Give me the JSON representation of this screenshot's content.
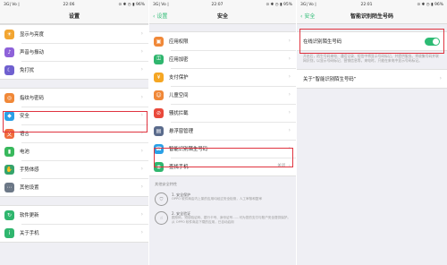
{
  "colors": {
    "accent": "#2dbb74",
    "highlight": "#e0333f"
  },
  "phone1": {
    "status": {
      "carrier": "3G| Vo |",
      "time": "22:06",
      "right": "⊙ ✱ ◷ ▮ 96%"
    },
    "title": "设置",
    "group1": [
      {
        "label": "显示与亮度",
        "icon": "sun-icon",
        "color": "#f2a531",
        "glyph": "☀"
      },
      {
        "label": "声音与振动",
        "icon": "speaker-icon",
        "color": "#8e62d9",
        "glyph": "♪"
      },
      {
        "label": "免打扰",
        "icon": "moon-icon",
        "color": "#6f60cf",
        "glyph": "☾"
      }
    ],
    "group2": [
      {
        "label": "指纹与密码",
        "icon": "fingerprint-icon",
        "color": "#f08838",
        "glyph": "◎"
      },
      {
        "label": "安全",
        "icon": "shield-icon",
        "color": "#2aa0e6",
        "glyph": "◆"
      },
      {
        "label": "语言",
        "icon": "language-icon",
        "color": "#f06b3c",
        "glyph": "文"
      },
      {
        "label": "电池",
        "icon": "battery-icon",
        "color": "#38b85c",
        "glyph": "▮"
      },
      {
        "label": "手势体感",
        "icon": "gesture-icon",
        "color": "#35a46c",
        "glyph": "✋"
      },
      {
        "label": "其他设置",
        "icon": "more-settings-icon",
        "color": "#6c7887",
        "glyph": "⋯"
      }
    ],
    "group3": [
      {
        "label": "软件更新",
        "icon": "update-icon",
        "color": "#2fb66e",
        "glyph": "↻"
      },
      {
        "label": "关于手机",
        "icon": "info-icon",
        "color": "#2fb66e",
        "glyph": "i"
      }
    ]
  },
  "phone2": {
    "status": {
      "carrier": "3G| Vo |",
      "time": "22:07",
      "right": "⊙ ✱ ◷ ▮ 95%"
    },
    "title": "安全",
    "back": "设置",
    "items": [
      {
        "label": "应用权限",
        "icon": "app-permission-icon",
        "color": "#f08838",
        "glyph": "▣"
      },
      {
        "label": "应用加密",
        "icon": "lock-icon",
        "color": "#2fb66e",
        "glyph": "⚿"
      },
      {
        "label": "支付保护",
        "icon": "payment-protect-icon",
        "color": "#f5a623",
        "glyph": "¥"
      },
      {
        "label": "儿童空间",
        "icon": "kid-icon",
        "color": "#f08838",
        "glyph": "☺"
      },
      {
        "label": "骚扰拦截",
        "icon": "block-icon",
        "color": "#e9493b",
        "glyph": "⊘"
      },
      {
        "label": "悬浮窗管理",
        "icon": "float-window-icon",
        "color": "#5a6b8c",
        "glyph": "▤"
      },
      {
        "label": "智能识别陌生号码",
        "icon": "contact-id-icon",
        "color": "#2aa0e6",
        "glyph": "☎"
      },
      {
        "label": "查找手机",
        "icon": "find-phone-icon",
        "color": "#2fb66e",
        "glyph": "◉",
        "right": "关闭"
      }
    ],
    "section_header": "其他安全特性",
    "tips": [
      {
        "icon": "shield-outline-icon",
        "glyph": "⛉",
        "title": "1. 安全保护",
        "text": "OPPO 软件商店内上架的应用均经过安全检测，人工审核和复审"
      },
      {
        "icon": "hand-outline-icon",
        "glyph": "☝",
        "title": "2. 安全验证",
        "text": "图形码、短信验证码、银行卡号、身份证号……可为您的支付与账户安全提供保护。从 OPPO 软件商店下载的应用，已自动启用"
      }
    ]
  },
  "phone3": {
    "status": {
      "carrier": "3G| Vo |",
      "time": "22:01",
      "right": "⊙ ✱ ◷ ▮ 96%"
    },
    "title": "智能识别陌生号码",
    "back": "安全",
    "toggle_label": "在线识别陌生号码",
    "toggle_on": true,
    "description": "开启后，陌生号码来电、通话记录、短信中将显示号码标记，并提供服务。将收集号码并联网识别，以显示号码标记、营销信息等，来电时，只能在来电中显示号码标记。",
    "about_label": "关于“智能识别陌生号码”"
  }
}
